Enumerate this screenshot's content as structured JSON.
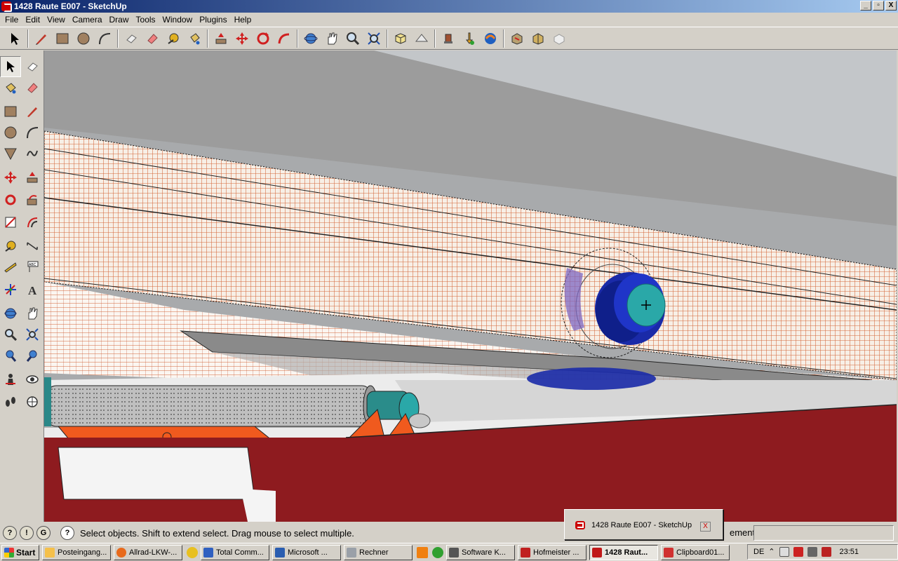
{
  "window": {
    "title": "1428 Raute E007 - SketchUp",
    "controls": [
      "_",
      "▫",
      "X"
    ]
  },
  "menu": [
    "File",
    "Edit",
    "View",
    "Camera",
    "Draw",
    "Tools",
    "Window",
    "Plugins",
    "Help"
  ],
  "toolbar_icons": [
    "select-icon",
    "pencil-icon",
    "rectangle-icon",
    "circle-icon",
    "arc-icon",
    "eraser-icon",
    "eraser-pink-icon",
    "tape-measure-icon",
    "paint-bucket-icon",
    "push-pull-icon",
    "move-icon",
    "rotate-icon",
    "follow-me-icon",
    "orbit-icon",
    "pan-icon",
    "zoom-icon",
    "zoom-extents-icon",
    "iso-view-icon",
    "top-view-icon",
    "components-icon",
    "get-models-icon",
    "share-model-icon",
    "3d-warehouse-icon",
    "add-location-icon",
    "toggle-terrain-icon"
  ],
  "status": {
    "text": "Select objects. Shift to extend select. Drag mouse to select multiple.",
    "measurements_label": "ements"
  },
  "popup": {
    "label": "1428 Raute E007 - SketchUp",
    "close": "X"
  },
  "taskbar": {
    "start": "Start",
    "tasks": [
      {
        "label": "Posteingang...",
        "color": "#f5c04a"
      },
      {
        "label": "Allrad-LKW-...",
        "color": "#e86a1c"
      },
      {
        "label": "Total Comm...",
        "color": "#3060c0"
      },
      {
        "label": "Microsoft ...",
        "color": "#2a5db0"
      },
      {
        "label": "Rechner",
        "color": "#9aa0a8"
      },
      {
        "label": "Software K...",
        "color": "#555555"
      },
      {
        "label": "Hofmeister ...",
        "color": "#c02020"
      },
      {
        "label": "1428 Raut...",
        "color": "#c01818",
        "active": true
      },
      {
        "label": "Clipboard01...",
        "color": "#d03030"
      }
    ],
    "lang": "DE",
    "clock": "23:51"
  },
  "colors": {
    "mesh": "#d4683a",
    "frame_red": "#8e1b1f",
    "hub_blue": "#1a2aa8",
    "cap_teal": "#2aa8a8",
    "bracket_orange": "#f05a1e"
  }
}
